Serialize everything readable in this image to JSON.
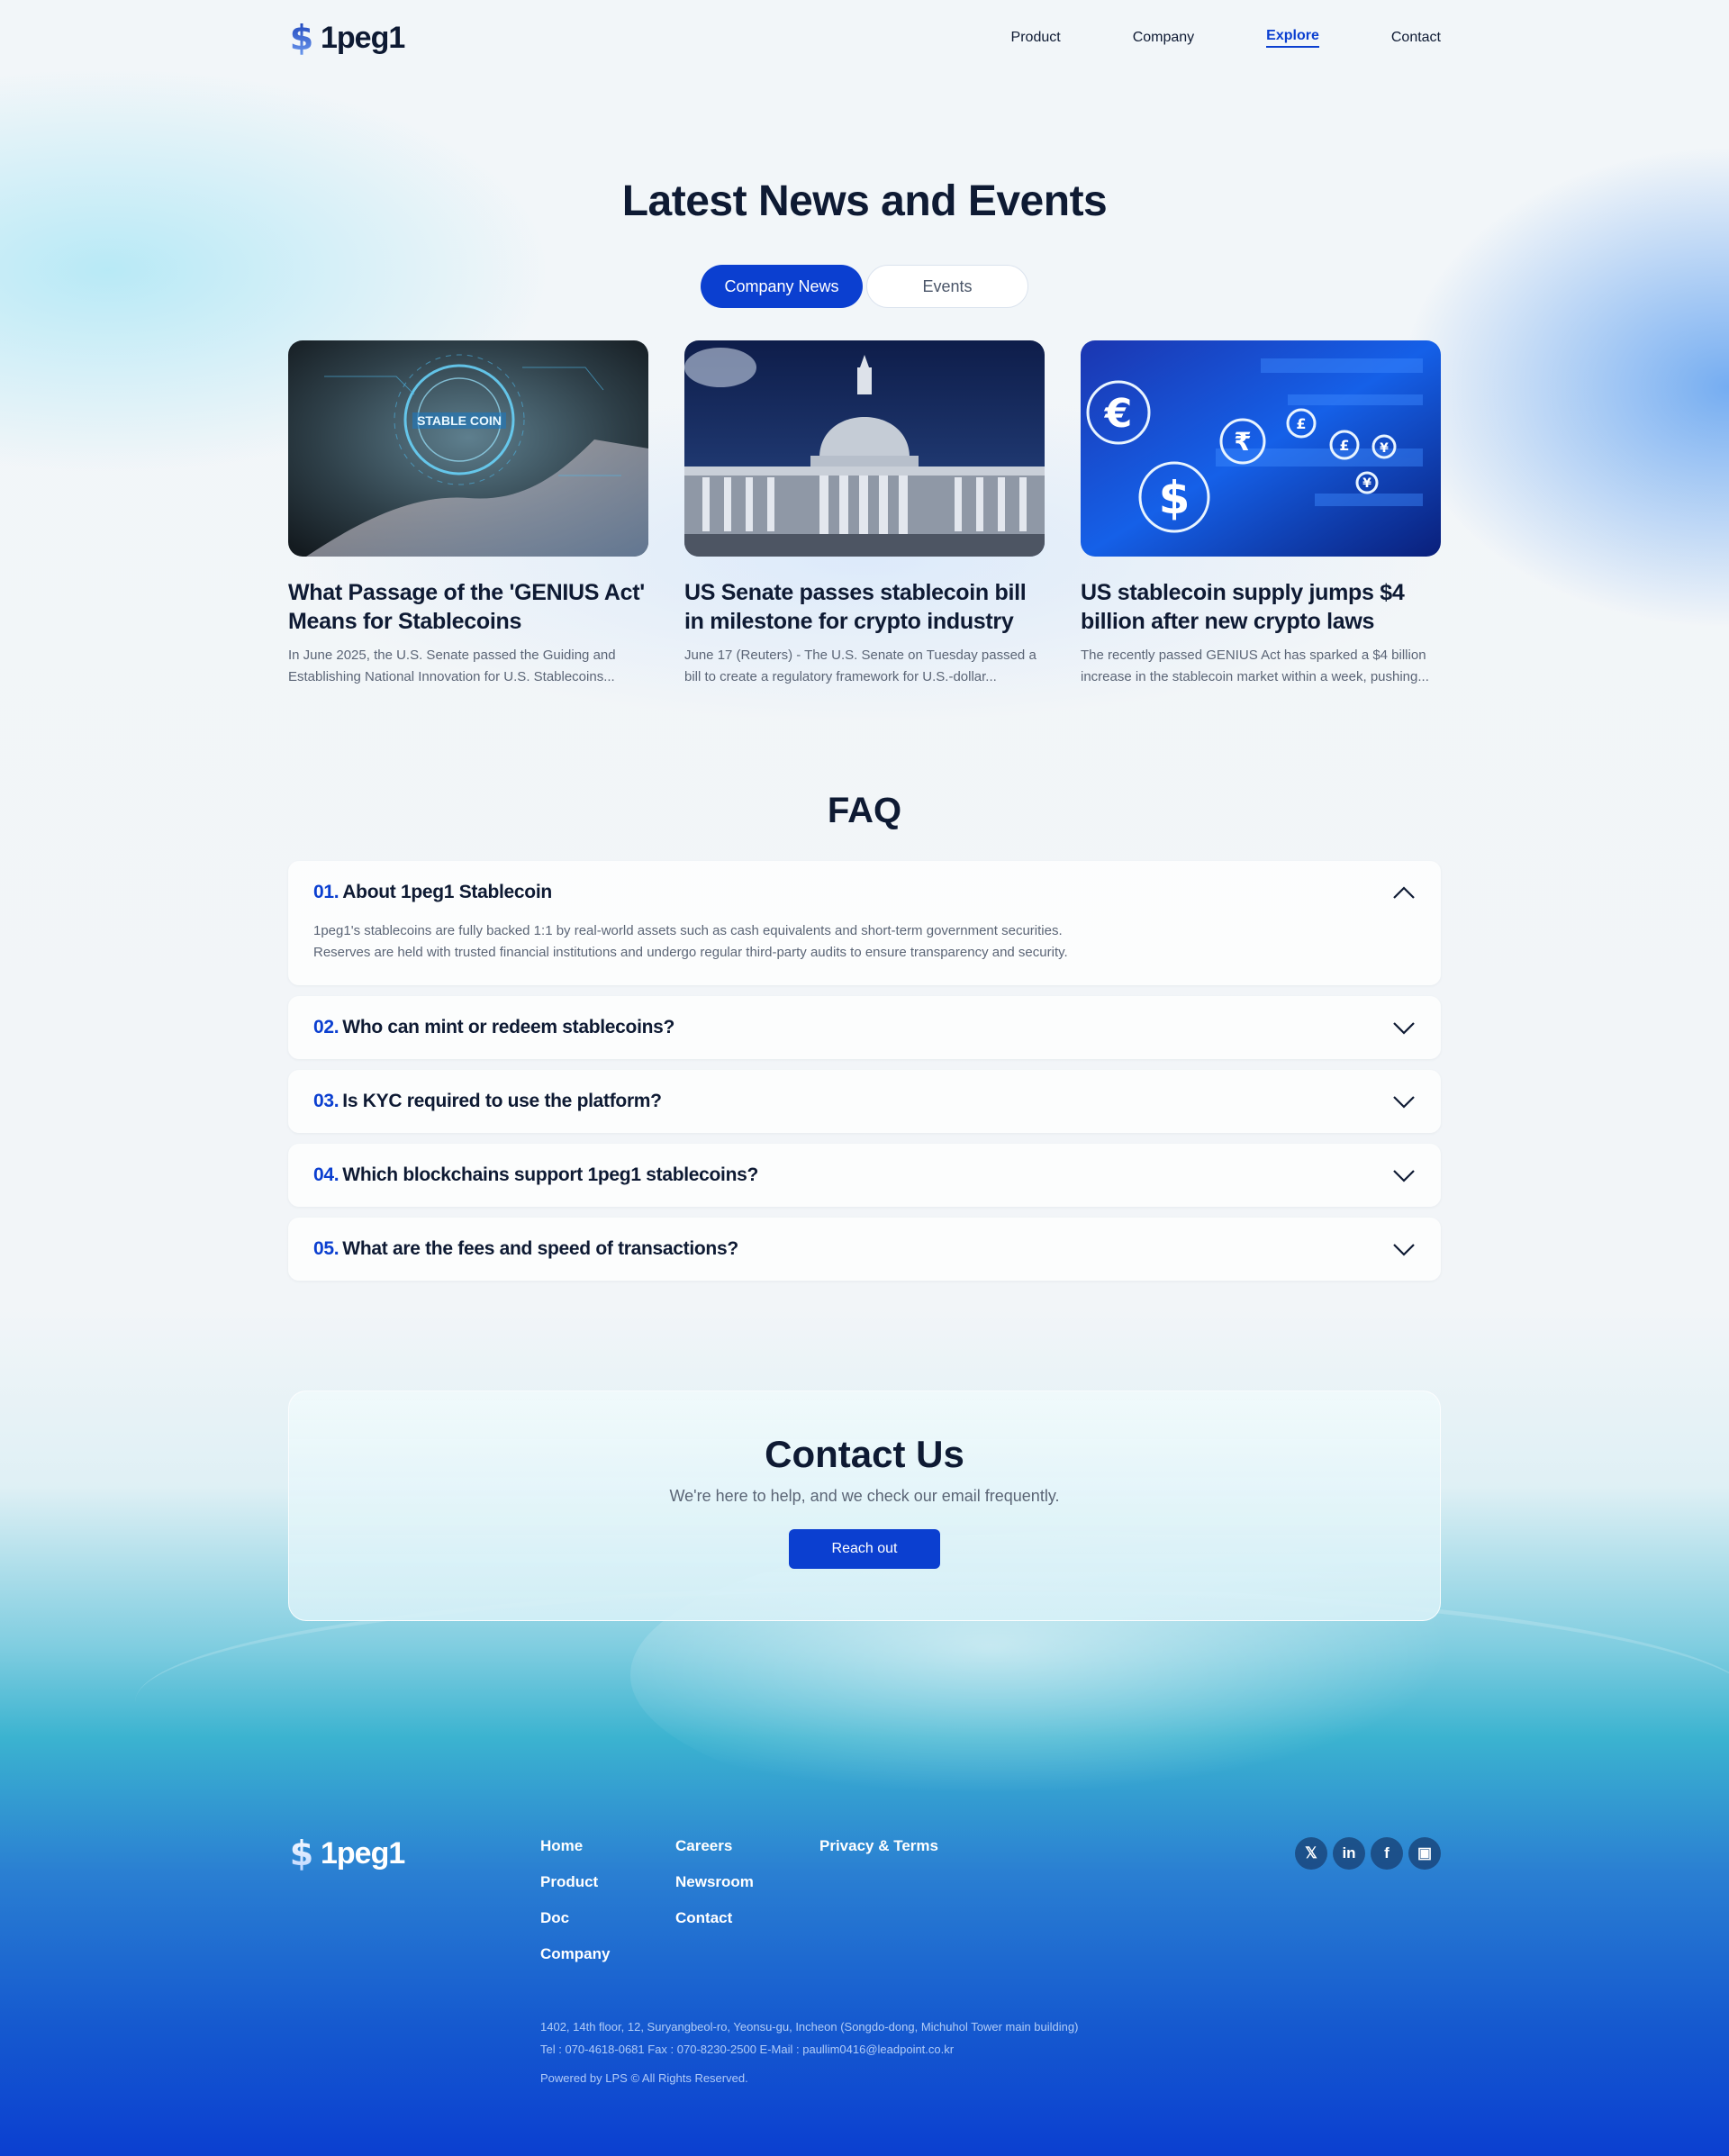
{
  "brand": {
    "name": "1peg1",
    "mark_icon": "dollar-coin-icon",
    "accent": "#0b3fd0"
  },
  "nav": [
    {
      "label": "Product",
      "active": false
    },
    {
      "label": "Company",
      "active": false
    },
    {
      "label": "Explore",
      "active": true
    },
    {
      "label": "Contact",
      "active": false
    }
  ],
  "news": {
    "title": "Latest News and Events",
    "tabs": [
      {
        "label": "Company News",
        "active": true
      },
      {
        "label": "Events",
        "active": false
      }
    ],
    "cards": [
      {
        "image_icon": "stable-coin-hand-image",
        "image_text": "STABLE COIN",
        "title": "What Passage of the 'GENIUS Act' Means for Stablecoins",
        "desc": "In June 2025, the U.S. Senate passed the Guiding and Establishing National Innovation for U.S. Stablecoins..."
      },
      {
        "image_icon": "capitol-building-image",
        "title": "US Senate passes stablecoin bill in milestone for crypto industry",
        "desc": "June 17 (Reuters) - The U.S. Senate on Tuesday passed a bill to create a regulatory framework for U.S.-dollar..."
      },
      {
        "image_icon": "currency-symbols-image",
        "title": "US stablecoin supply jumps $4 billion after new crypto laws",
        "desc": "The recently passed GENIUS Act has sparked a $4 billion increase in the stablecoin market within a week, pushing..."
      }
    ]
  },
  "faq": {
    "title": "FAQ",
    "items": [
      {
        "num": "01.",
        "question": "About 1peg1 Stablecoin",
        "expanded": true,
        "answer_lines": [
          "1peg1's stablecoins are fully backed 1:1 by real-world assets such as cash equivalents and short-term government securities.",
          "Reserves are held with trusted financial institutions and undergo regular third-party audits to ensure transparency and security."
        ]
      },
      {
        "num": "02.",
        "question": "Who can mint or redeem stablecoins?",
        "expanded": false
      },
      {
        "num": "03.",
        "question": "Is KYC required to use the platform?",
        "expanded": false
      },
      {
        "num": "04.",
        "question": "Which blockchains support 1peg1 stablecoins?",
        "expanded": false
      },
      {
        "num": "05.",
        "question": "What are the fees and speed of transactions?",
        "expanded": false
      }
    ]
  },
  "contact": {
    "title": "Contact Us",
    "subtitle": "We're here to help, and we check our email frequently.",
    "button": "Reach out"
  },
  "footer": {
    "col1": [
      "Home",
      "Product",
      "Doc",
      "Company"
    ],
    "col2": [
      "Careers",
      "Newsroom",
      "Contact"
    ],
    "col3": [
      "Privacy & Terms"
    ],
    "social": [
      {
        "icon": "x-icon",
        "glyph": "𝕏"
      },
      {
        "icon": "linkedin-icon",
        "glyph": "in"
      },
      {
        "icon": "facebook-icon",
        "glyph": "f"
      },
      {
        "icon": "blog-icon",
        "glyph": "▣"
      }
    ],
    "address": "1402, 14th floor, 12, Suryangbeol-ro, Yeonsu-gu, Incheon (Songdo-dong, Michuhol Tower main building)",
    "contact_line": "Tel : 070-4618-0681 Fax : 070-8230-2500 E-Mail : paullim0416@leadpoint.co.kr",
    "powered": "Powered by LPS © All Rights Reserved."
  }
}
